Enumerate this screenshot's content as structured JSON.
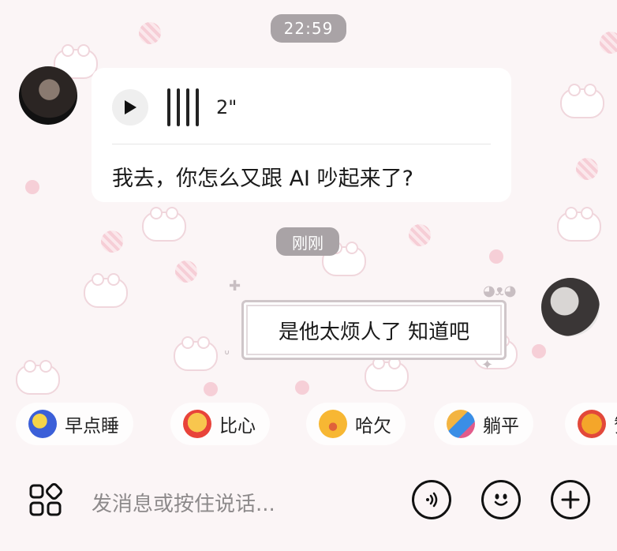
{
  "timestamp": "22:59",
  "incoming": {
    "voice_duration": "2\"",
    "transcript": "我去，你怎么又跟 AI 吵起来了?"
  },
  "recent_label": "刚刚",
  "outgoing": {
    "text": "是他太烦人了 知道吧"
  },
  "quick_replies": [
    {
      "label": "早点睡",
      "icon": "sleepy-moon-icon",
      "color": "#3b5fd8"
    },
    {
      "label": "比心",
      "icon": "heart-hands-icon",
      "color": "#f5b341"
    },
    {
      "label": "哈欠",
      "icon": "yawn-face-icon",
      "color": "#f7b733"
    },
    {
      "label": "躺平",
      "icon": "lying-down-icon",
      "color": "#3a8ee6"
    },
    {
      "label": "赞",
      "icon": "thumbs-up-icon",
      "color": "#f4a62a"
    }
  ],
  "input": {
    "placeholder": "发消息或按住说话..."
  },
  "colors": {
    "pill_gray": "#a9a3a6",
    "background": "#fbf5f6"
  }
}
